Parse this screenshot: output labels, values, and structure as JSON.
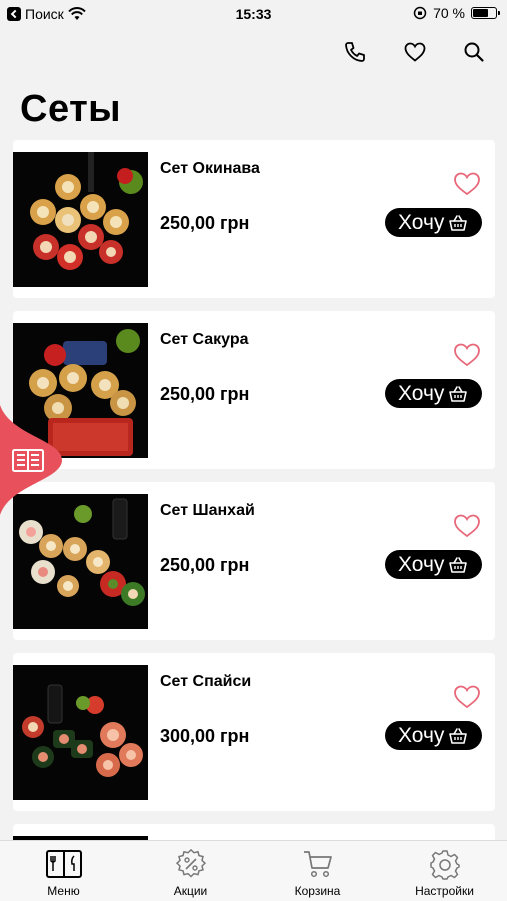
{
  "status_bar": {
    "carrier": "Поиск",
    "time": "15:33",
    "battery": "70 %",
    "battery_level": 0.7
  },
  "header_icons": [
    "phone-icon",
    "heart-icon",
    "search-icon"
  ],
  "page_title": "Сеты",
  "products": [
    {
      "name": "Сет Окинава",
      "price": "250,00 грн",
      "button": "Хочу"
    },
    {
      "name": "Сет Сакура",
      "price": "250,00 грн",
      "button": "Хочу"
    },
    {
      "name": "Сет Шанхай",
      "price": "250,00 грн",
      "button": "Хочу"
    },
    {
      "name": "Сет Спайси",
      "price": "300,00 грн",
      "button": "Хочу"
    }
  ],
  "colors": {
    "accent": "#e8505b",
    "heart": "#e8687a",
    "button_bg": "#000000"
  },
  "tabbar": [
    {
      "label": "Меню",
      "icon": "menu-book-icon"
    },
    {
      "label": "Акции",
      "icon": "discount-icon"
    },
    {
      "label": "Корзина",
      "icon": "cart-icon"
    },
    {
      "label": "Настройки",
      "icon": "gear-icon"
    }
  ]
}
